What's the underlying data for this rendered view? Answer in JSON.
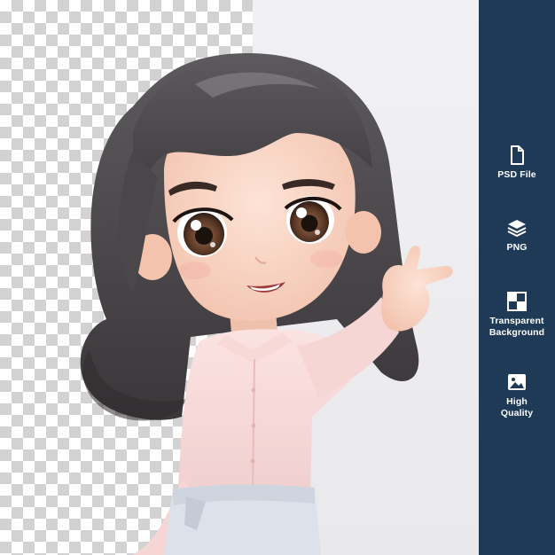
{
  "sidebar": {
    "background_color": "#1f3a56",
    "features": [
      {
        "icon": "file-icon",
        "label": "PSD File"
      },
      {
        "icon": "layers-icon",
        "label": "PNG"
      },
      {
        "icon": "transparency-grid-icon",
        "label": "Transparent\nBackground"
      },
      {
        "icon": "image-icon",
        "label": "High\nQuality"
      }
    ]
  }
}
